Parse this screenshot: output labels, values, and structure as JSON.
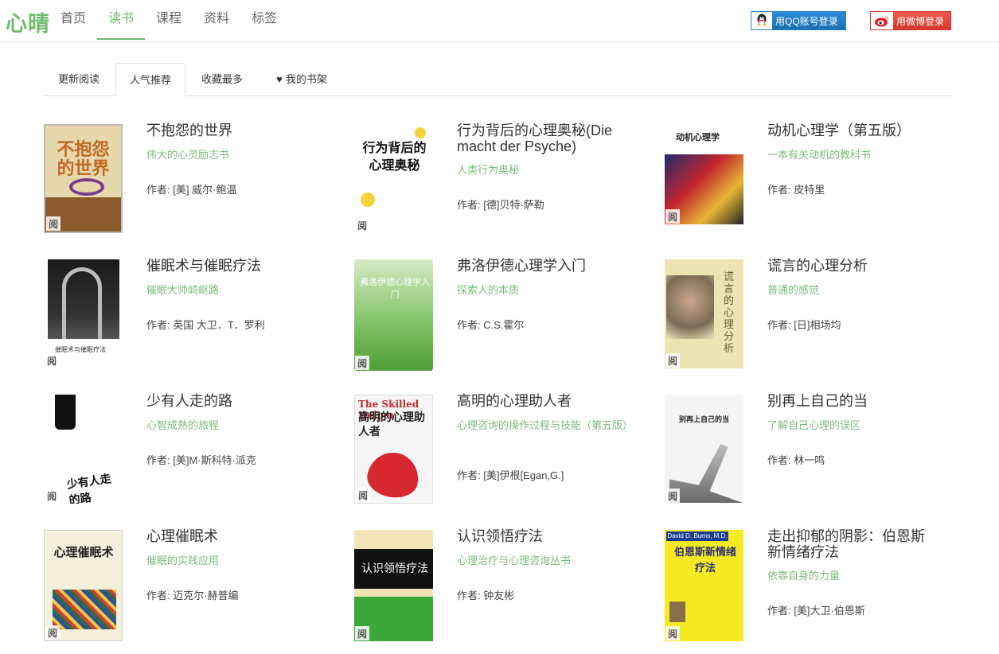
{
  "header": {
    "logo": "心晴",
    "nav": [
      "首页",
      "读书",
      "课程",
      "资料",
      "标签"
    ],
    "active_nav": "读书",
    "qq_login": "用QQ账号登录",
    "weibo_login": "用微博登录"
  },
  "tabs": {
    "latest": "更新阅读",
    "popular": "人气推荐",
    "favorites": "收藏最多",
    "shelf": "我的书架",
    "active": "人气推荐"
  },
  "read_badge": "阅",
  "books": [
    {
      "title": "不抱怨的世界",
      "subtitle": "伟大的心灵励志书",
      "author": "作者: [美] 威尔·鲍温",
      "cover_text": "不抱怨的世界",
      "cover_color": "#c9a35a"
    },
    {
      "title": "行为背后的心理奥秘(Die macht der Psyche)",
      "subtitle": "人类行为奥秘",
      "author": "作者: [德]贝特·萨勒",
      "cover_text": "行为背后的心理奥秘",
      "cover_color": "#ffffff"
    },
    {
      "title": "动机心理学（第五版）",
      "subtitle": "一本有关动机的教科书",
      "author": "作者: 皮特里",
      "cover_text": "动机心理学",
      "cover_color": "#2b2a3d"
    },
    {
      "title": "催眠术与催眠疗法",
      "subtitle": "催眠大师崎岖路",
      "author": "作者: 英国 大卫．T．罗利",
      "cover_text": "催眠术与催眠疗法",
      "cover_color": "#1a1a1a"
    },
    {
      "title": "弗洛伊德心理学入门",
      "subtitle": "探索人的本质",
      "author": "作者: C.S.霍尔",
      "cover_text": "弗洛伊德心理学入门",
      "cover_color": "#8bc56f"
    },
    {
      "title": "谎言的心理分析",
      "subtitle": "普通的感觉",
      "author": "作者: [日]相场均",
      "cover_text": "谎言的心理分析",
      "cover_color": "#e9e1a8"
    },
    {
      "title": "少有人走的路",
      "subtitle": "心智成熟的旅程",
      "author": "作者: [美]M·斯科特·派克",
      "cover_text": "少有人走的路",
      "cover_color": "#ffffff"
    },
    {
      "title": "高明的心理助人者",
      "subtitle": "心理咨询的操作过程与技能（第五版）",
      "author": "作者: [美]伊根[Egan,G.]",
      "cover_text": "高明的心理助人者",
      "cover_color": "#f4f4f4"
    },
    {
      "title": "别再上自己的当",
      "subtitle": "了解自己心理的误区",
      "author": "作者: 林一鸣",
      "cover_text": "别再上自己的当",
      "cover_color": "#dcdcdc"
    },
    {
      "title": "心理催眠术",
      "subtitle": "催眠的实践应用",
      "author": "作者: 迈克尔·赫普编",
      "cover_text": "心理催眠术",
      "cover_color": "#f2f0df"
    },
    {
      "title": "认识领悟疗法",
      "subtitle": "心理治疗与心理咨询丛书",
      "author": "作者: 钟友彬",
      "cover_text": "认识领悟疗法",
      "cover_color": "#3aa93a"
    },
    {
      "title": "走出抑郁的阴影：伯恩斯新情绪疗法",
      "subtitle": "依靠自身的力量",
      "author": "作者: [美]大卫·伯恩斯",
      "cover_text": "伯恩斯新情绪疗法",
      "cover_color": "#f6ea23"
    }
  ]
}
